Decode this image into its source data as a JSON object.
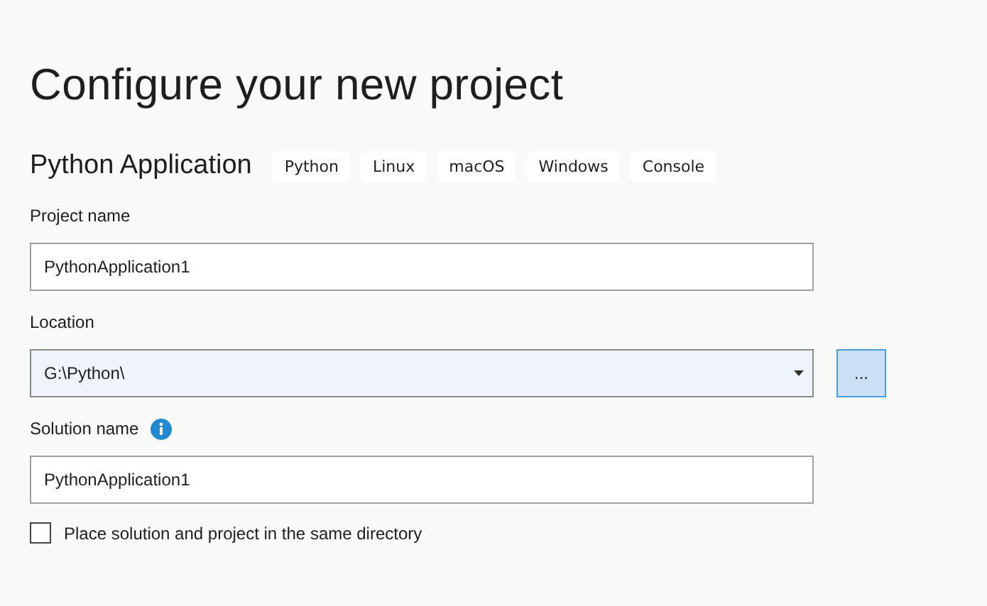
{
  "title": "Configure your new project",
  "template": {
    "name": "Python Application",
    "tags": [
      "Python",
      "Linux",
      "macOS",
      "Windows",
      "Console"
    ]
  },
  "fields": [
    {
      "kind": "text",
      "label": "Project name",
      "value": "PythonApplication1",
      "info": false
    },
    {
      "kind": "combo",
      "label": "Location",
      "value": "G:\\Python\\",
      "browse": "...",
      "info": false
    },
    {
      "kind": "text",
      "label": "Solution name",
      "value": "PythonApplication1",
      "info": true
    }
  ],
  "checkbox": {
    "label": "Place solution and project in the same directory",
    "checked": false
  }
}
